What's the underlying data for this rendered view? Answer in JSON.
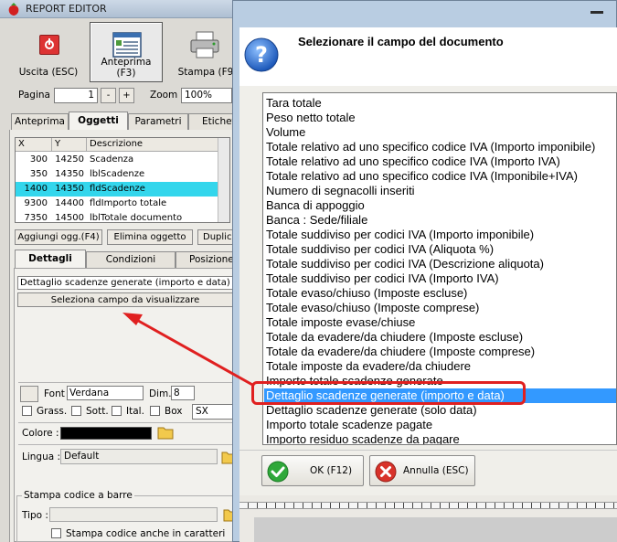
{
  "editor": {
    "title": "REPORT EDITOR",
    "toolbar": {
      "exit_label": "Uscita (ESC)",
      "preview_label": "Anteprima (F3)",
      "print_label": "Stampa (F9"
    },
    "page_label": "Pagina",
    "page_value": "1",
    "page_minus": "-",
    "page_plus": "+",
    "zoom_label": "Zoom",
    "zoom_value": "100%",
    "tabs": [
      "Anteprima",
      "Oggetti",
      "Parametri",
      "Etichet"
    ],
    "table": {
      "headers": [
        "X",
        "Y",
        "Descrizione"
      ],
      "rows": [
        {
          "x": "300",
          "y": "14250",
          "desc": "Scadenza"
        },
        {
          "x": "350",
          "y": "14350",
          "desc": "lblScadenze"
        },
        {
          "x": "1400",
          "y": "14350",
          "desc": "fldScadenze"
        },
        {
          "x": "9300",
          "y": "14400",
          "desc": "fldImporto totale"
        },
        {
          "x": "7350",
          "y": "14500",
          "desc": "lblTotale documento"
        }
      ],
      "selected_row": 2
    },
    "obj_buttons": [
      "Aggiungi ogg.(F4)",
      "Elimina oggetto",
      "Duplic"
    ],
    "subtabs": [
      "Dettagli",
      "Condizioni",
      "Posizione"
    ],
    "field_value": "Dettaglio scadenze generate (importo e data)",
    "select_field_button": "Seleziona campo da visualizzare",
    "font_label": "Font",
    "font_value": "Verdana",
    "dim_label": "Dim.",
    "dim_value": "8",
    "bold_label": "Grass.",
    "underline_label": "Sott.",
    "italic_label": "Ital.",
    "box_label": "Box",
    "align_value": "SX",
    "color_label": "Colore :",
    "color_value": "#000000",
    "language_label": "Lingua :",
    "language_value": "Default",
    "barcode_group": "Stampa codice a barre",
    "type_label": "Tipo :",
    "barcode_chars_label": "Stampa codice anche in caratteri"
  },
  "dialog": {
    "title": "Selezionare il campo del documento",
    "items": [
      "Tara totale",
      "Peso netto totale",
      "Volume",
      "Totale relativo ad uno specifico codice IVA (Importo imponibile)",
      "Totale relativo ad uno specifico codice IVA (Importo IVA)",
      "Totale relativo ad uno specifico codice IVA (Imponibile+IVA)",
      "Numero di segnacolli inseriti",
      "Banca di appoggio",
      "Banca : Sede/filiale",
      "Totale suddiviso per codici IVA (Importo imponibile)",
      "Totale suddiviso per codici IVA (Aliquota %)",
      "Totale suddiviso per codici IVA (Descrizione aliquota)",
      "Totale suddiviso per codici IVA (Importo IVA)",
      "Totale evaso/chiuso (Imposte escluse)",
      "Totale evaso/chiuso (Imposte comprese)",
      "Totale imposte evase/chiuse",
      "Totale da evadere/da chiudere (Imposte escluse)",
      "Totale da evadere/da chiudere (Imposte comprese)",
      "Totale imposte da evadere/da chiudere",
      "Importo totale scadenze generate",
      "Dettaglio scadenze generate (importo e data)",
      "Dettaglio scadenze generate (solo data)",
      "Importo totale scadenze pagate",
      "Importo residuo scadenze da pagare"
    ],
    "selected_index": 20,
    "ok_label": "OK (F12)",
    "cancel_label": "Annulla (ESC)"
  },
  "colors": {
    "selection": "#3399ff",
    "table_selection": "#33d6ec",
    "highlight": "#e02020",
    "ok_icon": "#2fa83a",
    "cancel_icon": "#d8322a"
  },
  "icons": [
    "app-strawberry-icon",
    "power-icon",
    "preview-icon",
    "printer-icon",
    "question-icon",
    "check-icon",
    "x-icon",
    "folder-icon",
    "minimize-icon"
  ]
}
